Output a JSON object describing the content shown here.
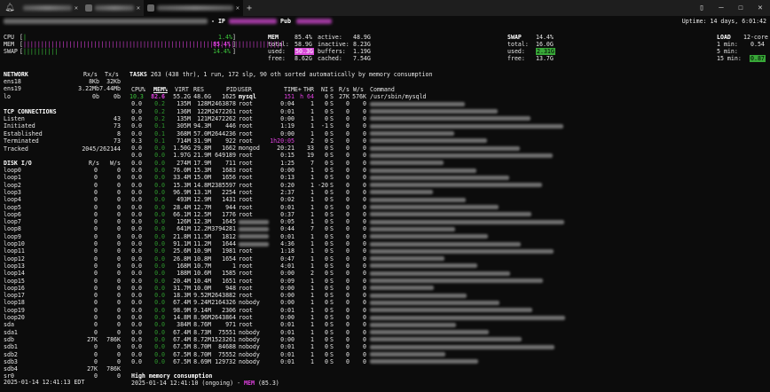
{
  "tabs": [
    {
      "label": ""
    },
    {
      "label": ""
    },
    {
      "label": ""
    }
  ],
  "header": {
    "ip_label": "IP",
    "pub_label": "Pub",
    "uptime": "Uptime: 14 days, 6:01:42"
  },
  "quicklook": {
    "cpu": {
      "label": "CPU",
      "value": "1.4%"
    },
    "mem": {
      "label": "MEM",
      "value": "85.4%"
    },
    "swap": {
      "label": "SWAP",
      "value": "14.4%"
    }
  },
  "mem": {
    "title": "MEM",
    "pct": "85.4%",
    "active_label": "active:",
    "active": "48.9G",
    "total_label": "total:",
    "total": "58.9G",
    "inactive_label": "inactive:",
    "inactive": "8.23G",
    "used_label": "used:",
    "used": "50.3G",
    "buffers_label": "buffers:",
    "buffers": "1.19G",
    "free_label": "free:",
    "free": "8.62G",
    "cached_label": "cached:",
    "cached": "7.54G"
  },
  "swap": {
    "title": "SWAP",
    "pct": "14.4%",
    "total_label": "total:",
    "total": "16.0G",
    "used_label": "used:",
    "used": "2.31G",
    "free_label": "free:",
    "free": "13.7G"
  },
  "load": {
    "title": "LOAD",
    "cores": "12-core",
    "l1_label": "1 min:",
    "l1": "0.54",
    "l5_label": "5 min:",
    "l5": "",
    "l15_label": "15 min:",
    "l15": "0.87"
  },
  "network": {
    "title": "NETWORK",
    "rx_label": "Rx/s",
    "tx_label": "Tx/s",
    "rows": [
      {
        "name": "ens18",
        "rx": "8Kb",
        "tx": "32Kb"
      },
      {
        "name": "ens19",
        "rx": "3.22Mb",
        "tx": "7.44Mb"
      },
      {
        "name": "lo",
        "rx": "0b",
        "tx": "0b"
      }
    ]
  },
  "tcp": {
    "title": "TCP CONNECTIONS",
    "rows": [
      {
        "name": "Listen",
        "val": "43"
      },
      {
        "name": "Initiated",
        "val": "73"
      },
      {
        "name": "Established",
        "val": "8"
      },
      {
        "name": "Terminated",
        "val": "73"
      },
      {
        "name": "Tracked",
        "val": "2045/262144"
      }
    ]
  },
  "disk": {
    "title": "DISK I/O",
    "r_label": "R/s",
    "w_label": "W/s",
    "rows": [
      {
        "name": "loop0",
        "r": "0",
        "w": "0"
      },
      {
        "name": "loop1",
        "r": "0",
        "w": "0"
      },
      {
        "name": "loop2",
        "r": "0",
        "w": "0"
      },
      {
        "name": "loop3",
        "r": "0",
        "w": "0"
      },
      {
        "name": "loop4",
        "r": "0",
        "w": "0"
      },
      {
        "name": "loop5",
        "r": "0",
        "w": "0"
      },
      {
        "name": "loop6",
        "r": "0",
        "w": "0"
      },
      {
        "name": "loop7",
        "r": "0",
        "w": "0"
      },
      {
        "name": "loop8",
        "r": "0",
        "w": "0"
      },
      {
        "name": "loop9",
        "r": "0",
        "w": "0"
      },
      {
        "name": "loop10",
        "r": "0",
        "w": "0"
      },
      {
        "name": "loop11",
        "r": "0",
        "w": "0"
      },
      {
        "name": "loop12",
        "r": "0",
        "w": "0"
      },
      {
        "name": "loop13",
        "r": "0",
        "w": "0"
      },
      {
        "name": "loop14",
        "r": "0",
        "w": "0"
      },
      {
        "name": "loop15",
        "r": "0",
        "w": "0"
      },
      {
        "name": "loop16",
        "r": "0",
        "w": "0"
      },
      {
        "name": "loop17",
        "r": "0",
        "w": "0"
      },
      {
        "name": "loop18",
        "r": "0",
        "w": "0"
      },
      {
        "name": "loop19",
        "r": "0",
        "w": "0"
      },
      {
        "name": "loop20",
        "r": "0",
        "w": "0"
      },
      {
        "name": "sda",
        "r": "0",
        "w": "0"
      },
      {
        "name": "sda1",
        "r": "0",
        "w": "0"
      },
      {
        "name": "sdb",
        "r": "27K",
        "w": "786K"
      },
      {
        "name": "sdb1",
        "r": "0",
        "w": "0"
      },
      {
        "name": "sdb2",
        "r": "0",
        "w": "0"
      },
      {
        "name": "sdb3",
        "r": "0",
        "w": "0"
      },
      {
        "name": "sdb4",
        "r": "27K",
        "w": "786K"
      },
      {
        "name": "sr0",
        "r": "0",
        "w": "0"
      }
    ]
  },
  "tasks": {
    "line_label": "TASKS",
    "line": "263 (438 thr), 1 run, 172 slp, 90 oth sorted automatically by memory consumption"
  },
  "proc_headers": {
    "cpu": "CPU%",
    "mem": "MEM%",
    "virt": "VIRT",
    "res": "RES",
    "pid": "PID",
    "user": "USER",
    "time": "TIME+",
    "thr": "THR",
    "ni": "NI",
    "s": "S",
    "rs": "R/s",
    "ws": "W/s",
    "cmd": "Command"
  },
  "processes": [
    {
      "cpu": "10.3",
      "mem": "82.6",
      "virt": "55.2G",
      "res": "48.6G",
      "pid": "1625",
      "user": "mysql",
      "time": "151",
      "thr": "h 64",
      "ni": "0",
      "s": "S",
      "rs": "27K",
      "ws": "576K",
      "cmd": "/usr/sbin/mysqld"
    },
    {
      "cpu": "0.0",
      "mem": "0.2",
      "virt": "135M",
      "res": "128M",
      "pid": "2463878",
      "user": "root",
      "time": "0:04",
      "thr": "1",
      "ni": "0",
      "s": "S",
      "rs": "0",
      "ws": "0",
      "cmd": ""
    },
    {
      "cpu": "0.0",
      "mem": "0.2",
      "virt": "136M",
      "res": "122M",
      "pid": "2472261",
      "user": "root",
      "time": "0:01",
      "thr": "1",
      "ni": "0",
      "s": "S",
      "rs": "0",
      "ws": "0",
      "cmd": ""
    },
    {
      "cpu": "0.0",
      "mem": "0.2",
      "virt": "135M",
      "res": "121M",
      "pid": "2472262",
      "user": "root",
      "time": "0:00",
      "thr": "1",
      "ni": "0",
      "s": "S",
      "rs": "0",
      "ws": "0",
      "cmd": ""
    },
    {
      "cpu": "0.0",
      "mem": "0.1",
      "virt": "305M",
      "res": "94.3M",
      "pid": "446",
      "user": "root",
      "time": "1:19",
      "thr": "1",
      "ni": "-1",
      "s": "S",
      "rs": "0",
      "ws": "0",
      "cmd": ""
    },
    {
      "cpu": "0.0",
      "mem": "0.1",
      "virt": "368M",
      "res": "57.0M",
      "pid": "2644236",
      "user": "root",
      "time": "0:00",
      "thr": "1",
      "ni": "0",
      "s": "S",
      "rs": "0",
      "ws": "0",
      "cmd": ""
    },
    {
      "cpu": "0.3",
      "mem": "0.1",
      "virt": "714M",
      "res": "31.9M",
      "pid": "922",
      "user": "root",
      "time": "1h20:05",
      "thr": "2",
      "ni": "0",
      "s": "S",
      "rs": "0",
      "ws": "0",
      "cmd": ""
    },
    {
      "cpu": "0.0",
      "mem": "0.0",
      "virt": "1.50G",
      "res": "29.8M",
      "pid": "1662",
      "user": "mongod",
      "time": "20:21",
      "thr": "33",
      "ni": "0",
      "s": "S",
      "rs": "0",
      "ws": "0",
      "cmd": ""
    },
    {
      "cpu": "0.0",
      "mem": "0.0",
      "virt": "1.97G",
      "res": "21.9M",
      "pid": "649189",
      "user": "root",
      "time": "0:15",
      "thr": "19",
      "ni": "0",
      "s": "S",
      "rs": "0",
      "ws": "0",
      "cmd": ""
    },
    {
      "cpu": "0.0",
      "mem": "0.0",
      "virt": "274M",
      "res": "17.9M",
      "pid": "711",
      "user": "root",
      "time": "1:25",
      "thr": "7",
      "ni": "0",
      "s": "S",
      "rs": "0",
      "ws": "0",
      "cmd": ""
    },
    {
      "cpu": "0.0",
      "mem": "0.0",
      "virt": "76.0M",
      "res": "15.3M",
      "pid": "1683",
      "user": "root",
      "time": "0:00",
      "thr": "1",
      "ni": "0",
      "s": "S",
      "rs": "0",
      "ws": "0",
      "cmd": ""
    },
    {
      "cpu": "0.0",
      "mem": "0.0",
      "virt": "33.4M",
      "res": "15.0M",
      "pid": "1656",
      "user": "root",
      "time": "0:13",
      "thr": "1",
      "ni": "0",
      "s": "S",
      "rs": "0",
      "ws": "0",
      "cmd": ""
    },
    {
      "cpu": "0.0",
      "mem": "0.0",
      "virt": "15.3M",
      "res": "14.8M",
      "pid": "2385597",
      "user": "root",
      "time": "0:20",
      "thr": "1",
      "ni": "-20",
      "s": "S",
      "rs": "0",
      "ws": "0",
      "cmd": ""
    },
    {
      "cpu": "0.0",
      "mem": "0.0",
      "virt": "96.9M",
      "res": "13.1M",
      "pid": "2254",
      "user": "root",
      "time": "2:37",
      "thr": "1",
      "ni": "0",
      "s": "S",
      "rs": "0",
      "ws": "0",
      "cmd": ""
    },
    {
      "cpu": "0.0",
      "mem": "0.0",
      "virt": "493M",
      "res": "12.9M",
      "pid": "1431",
      "user": "root",
      "time": "0:02",
      "thr": "1",
      "ni": "0",
      "s": "S",
      "rs": "0",
      "ws": "0",
      "cmd": ""
    },
    {
      "cpu": "0.0",
      "mem": "0.0",
      "virt": "28.4M",
      "res": "12.7M",
      "pid": "944",
      "user": "root",
      "time": "0:01",
      "thr": "1",
      "ni": "0",
      "s": "S",
      "rs": "0",
      "ws": "0",
      "cmd": ""
    },
    {
      "cpu": "0.0",
      "mem": "0.0",
      "virt": "66.1M",
      "res": "12.5M",
      "pid": "1776",
      "user": "root",
      "time": "0:37",
      "thr": "1",
      "ni": "0",
      "s": "S",
      "rs": "0",
      "ws": "0",
      "cmd": ""
    },
    {
      "cpu": "0.0",
      "mem": "0.0",
      "virt": "126M",
      "res": "12.3M",
      "pid": "1645",
      "user": "",
      "time": "0:05",
      "thr": "1",
      "ni": "0",
      "s": "S",
      "rs": "0",
      "ws": "0",
      "cmd": ""
    },
    {
      "cpu": "0.0",
      "mem": "0.0",
      "virt": "641M",
      "res": "12.2M",
      "pid": "3794281",
      "user": "",
      "time": "0:44",
      "thr": "7",
      "ni": "0",
      "s": "S",
      "rs": "0",
      "ws": "0",
      "cmd": ""
    },
    {
      "cpu": "0.0",
      "mem": "0.0",
      "virt": "21.8M",
      "res": "11.5M",
      "pid": "1812",
      "user": "",
      "time": "0:01",
      "thr": "1",
      "ni": "0",
      "s": "S",
      "rs": "0",
      "ws": "0",
      "cmd": ""
    },
    {
      "cpu": "0.0",
      "mem": "0.0",
      "virt": "91.1M",
      "res": "11.2M",
      "pid": "1644",
      "user": "",
      "time": "4:36",
      "thr": "1",
      "ni": "0",
      "s": "S",
      "rs": "0",
      "ws": "0",
      "cmd": ""
    },
    {
      "cpu": "0.0",
      "mem": "0.0",
      "virt": "25.6M",
      "res": "10.9M",
      "pid": "1981",
      "user": "root",
      "time": "1:18",
      "thr": "1",
      "ni": "0",
      "s": "S",
      "rs": "0",
      "ws": "0",
      "cmd": ""
    },
    {
      "cpu": "0.0",
      "mem": "0.0",
      "virt": "26.8M",
      "res": "10.8M",
      "pid": "1654",
      "user": "root",
      "time": "0:47",
      "thr": "1",
      "ni": "0",
      "s": "S",
      "rs": "0",
      "ws": "0",
      "cmd": ""
    },
    {
      "cpu": "0.0",
      "mem": "0.0",
      "virt": "168M",
      "res": "10.7M",
      "pid": "1",
      "user": "root",
      "time": "4:01",
      "thr": "1",
      "ni": "0",
      "s": "S",
      "rs": "0",
      "ws": "0",
      "cmd": ""
    },
    {
      "cpu": "0.0",
      "mem": "0.0",
      "virt": "188M",
      "res": "10.6M",
      "pid": "1585",
      "user": "root",
      "time": "0:00",
      "thr": "2",
      "ni": "0",
      "s": "S",
      "rs": "0",
      "ws": "0",
      "cmd": ""
    },
    {
      "cpu": "0.0",
      "mem": "0.0",
      "virt": "20.4M",
      "res": "10.4M",
      "pid": "1651",
      "user": "root",
      "time": "0:09",
      "thr": "1",
      "ni": "0",
      "s": "S",
      "rs": "0",
      "ws": "0",
      "cmd": ""
    },
    {
      "cpu": "0.0",
      "mem": "0.0",
      "virt": "31.7M",
      "res": "10.0M",
      "pid": "948",
      "user": "root",
      "time": "0:00",
      "thr": "1",
      "ni": "0",
      "s": "S",
      "rs": "0",
      "ws": "0",
      "cmd": ""
    },
    {
      "cpu": "0.0",
      "mem": "0.0",
      "virt": "18.3M",
      "res": "9.52M",
      "pid": "2643882",
      "user": "root",
      "time": "0:00",
      "thr": "1",
      "ni": "0",
      "s": "S",
      "rs": "0",
      "ws": "0",
      "cmd": ""
    },
    {
      "cpu": "0.0",
      "mem": "0.0",
      "virt": "67.4M",
      "res": "9.24M",
      "pid": "2164326",
      "user": "nobody",
      "time": "0:00",
      "thr": "1",
      "ni": "0",
      "s": "S",
      "rs": "0",
      "ws": "0",
      "cmd": ""
    },
    {
      "cpu": "0.0",
      "mem": "0.0",
      "virt": "98.9M",
      "res": "9.14M",
      "pid": "2306",
      "user": "root",
      "time": "0:01",
      "thr": "1",
      "ni": "0",
      "s": "S",
      "rs": "0",
      "ws": "0",
      "cmd": ""
    },
    {
      "cpu": "0.0",
      "mem": "0.0",
      "virt": "14.8M",
      "res": "8.96M",
      "pid": "2643864",
      "user": "root",
      "time": "0:00",
      "thr": "1",
      "ni": "0",
      "s": "S",
      "rs": "0",
      "ws": "0",
      "cmd": ""
    },
    {
      "cpu": "0.0",
      "mem": "0.0",
      "virt": "384M",
      "res": "8.76M",
      "pid": "971",
      "user": "root",
      "time": "0:01",
      "thr": "1",
      "ni": "0",
      "s": "S",
      "rs": "0",
      "ws": "0",
      "cmd": ""
    },
    {
      "cpu": "0.0",
      "mem": "0.0",
      "virt": "67.4M",
      "res": "8.73M",
      "pid": "75551",
      "user": "nobody",
      "time": "0:01",
      "thr": "1",
      "ni": "0",
      "s": "S",
      "rs": "0",
      "ws": "0",
      "cmd": ""
    },
    {
      "cpu": "0.0",
      "mem": "0.0",
      "virt": "67.4M",
      "res": "8.72M",
      "pid": "1523261",
      "user": "nobody",
      "time": "0:00",
      "thr": "1",
      "ni": "0",
      "s": "S",
      "rs": "0",
      "ws": "0",
      "cmd": ""
    },
    {
      "cpu": "0.0",
      "mem": "0.0",
      "virt": "67.5M",
      "res": "8.70M",
      "pid": "84688",
      "user": "nobody",
      "time": "0:01",
      "thr": "1",
      "ni": "0",
      "s": "S",
      "rs": "0",
      "ws": "0",
      "cmd": ""
    },
    {
      "cpu": "0.0",
      "mem": "0.0",
      "virt": "67.5M",
      "res": "8.70M",
      "pid": "75552",
      "user": "nobody",
      "time": "0:01",
      "thr": "1",
      "ni": "0",
      "s": "S",
      "rs": "0",
      "ws": "0",
      "cmd": ""
    },
    {
      "cpu": "0.0",
      "mem": "0.0",
      "virt": "67.5M",
      "res": "8.69M",
      "pid": "129732",
      "user": "nobody",
      "time": "0:01",
      "thr": "1",
      "ni": "0",
      "s": "S",
      "rs": "0",
      "ws": "0",
      "cmd": ""
    }
  ],
  "footer": {
    "time": "2025-01-14 12:41:13 EDT",
    "alert_title": "High memory consumption",
    "alert_line": "2025-01-14 12:41:10 (ongoing) - ",
    "alert_mem": "MEM",
    "alert_val": " (85.3)"
  },
  "colors": {
    "bg": "#0c0c0c",
    "green": "#3cc63c",
    "magenta": "#e040e0",
    "red": "#e04a4a"
  }
}
